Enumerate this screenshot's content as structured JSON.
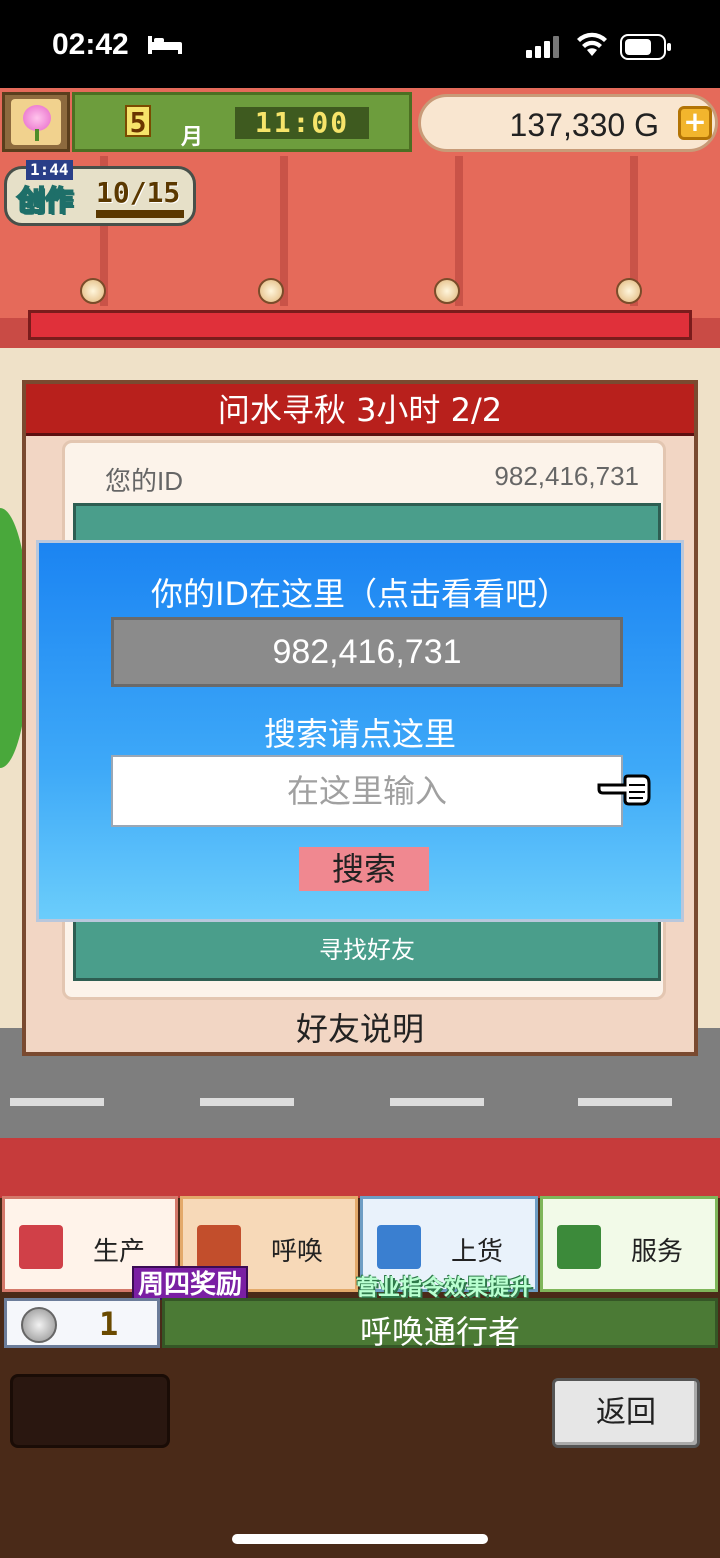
{
  "status_bar": {
    "time": "02:42"
  },
  "hud": {
    "month_number": "5",
    "month_label": "月",
    "clock": "11:00",
    "gold": "137,330 G",
    "gold_plus": "+",
    "create_label": "创作",
    "create_timer": "1:44",
    "create_count": "10/15"
  },
  "dialog": {
    "title": "问水寻秋  3小时 2/2",
    "my_id_label": "您的ID",
    "my_id_value": "982,416,731",
    "find_friend_label": "寻找好友",
    "friend_help": "好友说明"
  },
  "search_popup": {
    "title": "你的ID在这里（点击看看吧）",
    "id_value": "982,416,731",
    "search_label": "搜索请点这里",
    "input_placeholder": "在这里输入",
    "input_value": "",
    "search_button": "搜索"
  },
  "menu": {
    "items": [
      {
        "label": "生产",
        "icon": "produce-icon"
      },
      {
        "label": "呼唤",
        "icon": "call-icon"
      },
      {
        "label": "上货",
        "icon": "stock-icon"
      },
      {
        "label": "服务",
        "icon": "service-icon"
      }
    ],
    "thursday_bonus": "周四奖励",
    "effect_up": "营业指令效果提升",
    "coin_count": "1",
    "summon_label": "呼唤通行者",
    "back_button": "返回"
  }
}
